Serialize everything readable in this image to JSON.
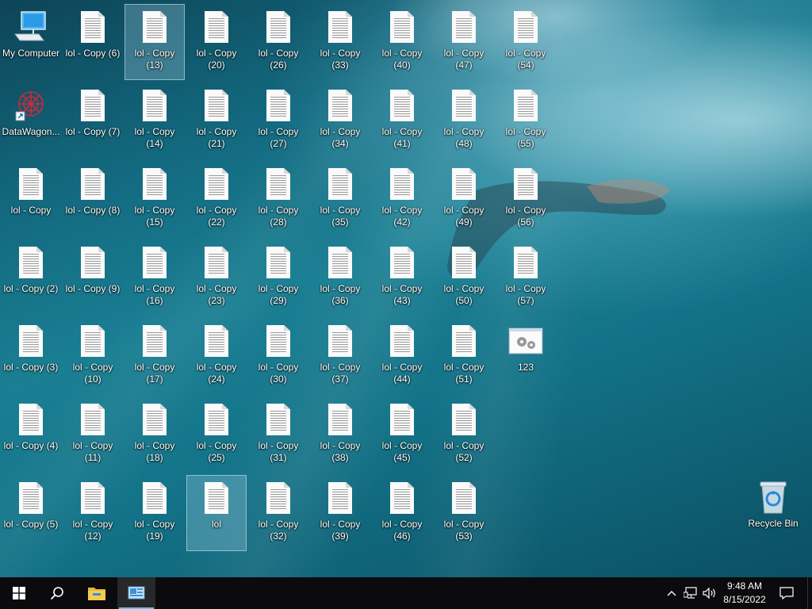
{
  "desktop": {
    "columns": [
      [
        "My Computer",
        "lol - Copy",
        "lol - Copy (2)",
        "lol - Copy (3)",
        "lol - Copy (4)",
        "lol - Copy (5)"
      ],
      [
        "lol - Copy (6)",
        "lol - Copy (7)",
        "lol - Copy (8)",
        "lol - Copy (9)",
        "lol - Copy (10)",
        "lol - Copy (11)",
        "lol - Copy (12)"
      ],
      [
        "lol - Copy (13)",
        "lol - Copy (14)",
        "lol - Copy (15)",
        "lol - Copy (16)",
        "lol - Copy (17)",
        "lol - Copy (18)",
        "lol - Copy (19)"
      ],
      [
        "lol - Copy (20)",
        "lol - Copy (21)",
        "lol - Copy (22)",
        "lol - Copy (23)",
        "lol - Copy (24)",
        "lol - Copy (25)",
        "lol"
      ],
      [
        "lol - Copy (26)",
        "lol - Copy (27)",
        "lol - Copy (28)",
        "lol - Copy (29)",
        "lol - Copy (30)",
        "lol - Copy (31)",
        "lol - Copy (32)"
      ],
      [
        "lol - Copy (33)",
        "lol - Copy (34)",
        "lol - Copy (35)",
        "lol - Copy (36)",
        "lol - Copy (37)",
        "lol - Copy (38)",
        "lol - Copy (39)"
      ],
      [
        "lol - Copy (40)",
        "lol - Copy (41)",
        "lol - Copy (42)",
        "lol - Copy (43)",
        "lol - Copy (44)",
        "lol - Copy (45)",
        "lol - Copy (46)"
      ],
      [
        "lol - Copy (47)",
        "lol - Copy (48)",
        "lol - Copy (49)",
        "lol - Copy (50)",
        "lol - Copy (51)",
        "lol - Copy (52)",
        "lol - Copy (53)"
      ],
      [
        "lol - Copy (54)",
        "lol - Copy (55)",
        "lol - Copy (56)",
        "lol - Copy (57)",
        "123"
      ]
    ],
    "special_first_column": {
      "my_computer": "My Computer",
      "datawagon": "DataWagon..."
    },
    "selected": [
      "lol - Copy (13)",
      "lol"
    ],
    "recycle_bin": "Recycle Bin"
  },
  "taskbar": {
    "start_icon": "windows-start-icon",
    "search_icon": "search-icon",
    "file_explorer_icon": "file-explorer-icon",
    "active_app_icon": "control-panel-app-icon",
    "tray": {
      "chevron_icon": "chevron-up-icon",
      "network_icon": "network-icon",
      "volume_icon": "volume-icon",
      "notification_icon": "action-center-icon"
    },
    "time": "9:48 AM",
    "date": "8/15/2022"
  },
  "colors": {
    "taskbar_bg": "#0b0b0d",
    "active_indicator": "#76b9ed",
    "selection": "#b4dcf0"
  }
}
